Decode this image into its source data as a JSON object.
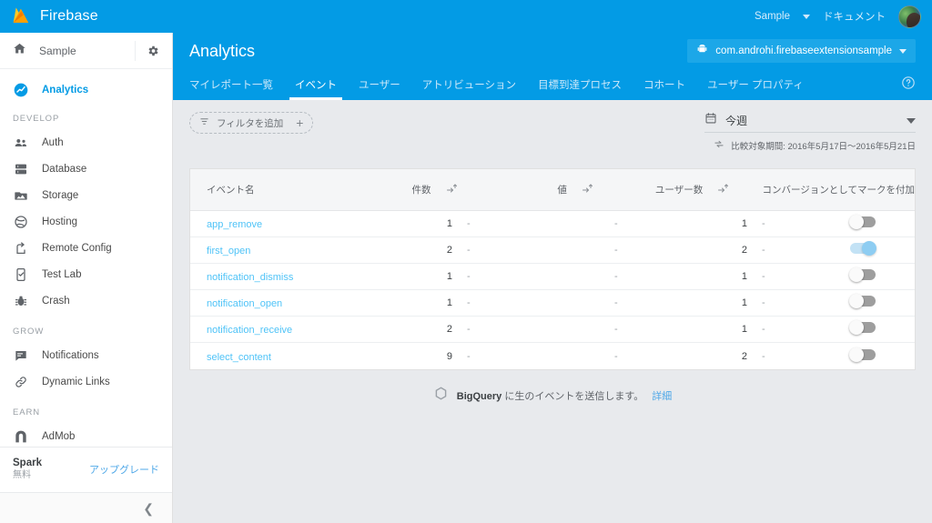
{
  "topbar": {
    "brand": "Firebase",
    "project_menu": "Sample",
    "docs_link": "ドキュメント",
    "brand_color": "#039be5"
  },
  "sidebar": {
    "project": {
      "name": "Sample",
      "home_icon": "home-icon",
      "settings_icon": "gear-icon"
    },
    "primary": [
      {
        "label": "Analytics",
        "icon": "analytics-icon",
        "active": true
      }
    ],
    "groups": [
      {
        "title": "DEVELOP",
        "items": [
          {
            "label": "Auth",
            "icon": "people-icon"
          },
          {
            "label": "Database",
            "icon": "database-icon"
          },
          {
            "label": "Storage",
            "icon": "storage-icon"
          },
          {
            "label": "Hosting",
            "icon": "hosting-icon"
          },
          {
            "label": "Remote Config",
            "icon": "remote-config-icon"
          },
          {
            "label": "Test Lab",
            "icon": "test-lab-icon"
          },
          {
            "label": "Crash",
            "icon": "bug-icon"
          }
        ]
      },
      {
        "title": "GROW",
        "items": [
          {
            "label": "Notifications",
            "icon": "message-icon"
          },
          {
            "label": "Dynamic Links",
            "icon": "link-icon"
          }
        ]
      },
      {
        "title": "EARN",
        "items": [
          {
            "label": "AdMob",
            "icon": "admob-icon"
          }
        ]
      }
    ],
    "plan": {
      "name": "Spark",
      "sub": "無料",
      "upgrade": "アップグレード"
    },
    "collapse_icon": "chevron-left-icon"
  },
  "main": {
    "title": "Analytics",
    "app_selector": {
      "label": "com.androhi.firebaseextensionsample",
      "icon": "android-icon"
    },
    "tabs": [
      {
        "label": "マイレポート一覧",
        "active": false
      },
      {
        "label": "イベント",
        "active": true
      },
      {
        "label": "ユーザー",
        "active": false
      },
      {
        "label": "アトリビューション",
        "active": false
      },
      {
        "label": "目標到達プロセス",
        "active": false
      },
      {
        "label": "コホート",
        "active": false
      },
      {
        "label": "ユーザー プロパティ",
        "active": false
      }
    ],
    "help_icon": "help-icon"
  },
  "controls": {
    "filter": {
      "label": "フィルタを追加",
      "filter_icon": "filter-icon",
      "plus_icon": "plus-icon"
    },
    "daterange": {
      "calendar_icon": "calendar-icon",
      "value": "今週",
      "compare_icon": "compare-arrows-icon",
      "compare_text": "比較対象期間: 2016年5月17日〜2016年5月21日"
    }
  },
  "table": {
    "columns": {
      "name": "イベント名",
      "count": "件数",
      "value": "値",
      "users": "ユーザー数",
      "conversion": "コンバージョンとしてマークを付加"
    },
    "sort_icon": "sort-icon",
    "rows": [
      {
        "name": "app_remove",
        "count": "1",
        "value": "-",
        "users": "1",
        "conversion_on": false
      },
      {
        "name": "first_open",
        "count": "2",
        "value": "-",
        "users": "2",
        "conversion_on": true
      },
      {
        "name": "notification_dismiss",
        "count": "1",
        "value": "-",
        "users": "1",
        "conversion_on": false
      },
      {
        "name": "notification_open",
        "count": "1",
        "value": "-",
        "users": "1",
        "conversion_on": false
      },
      {
        "name": "notification_receive",
        "count": "2",
        "value": "-",
        "users": "1",
        "conversion_on": false
      },
      {
        "name": "select_content",
        "count": "9",
        "value": "-",
        "users": "2",
        "conversion_on": false
      }
    ]
  },
  "bigquery": {
    "icon": "bigquery-icon",
    "brand": "BigQuery",
    "text": " に生のイベントを送信します。",
    "link": "詳細"
  }
}
